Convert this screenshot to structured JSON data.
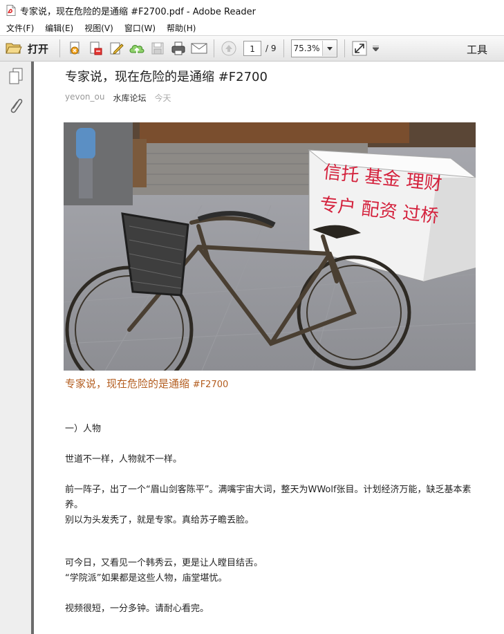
{
  "window": {
    "title": "专家说，现在危险的是通缩 #F2700.pdf - Adobe Reader"
  },
  "menu": [
    {
      "label": "文件(F)"
    },
    {
      "label": "编辑(E)"
    },
    {
      "label": "视图(V)"
    },
    {
      "label": "窗口(W)"
    },
    {
      "label": "帮助(H)"
    }
  ],
  "toolbar": {
    "open_label": "打开",
    "page_current": "1",
    "page_total": "/ 9",
    "zoom": "75.3%",
    "tools_label": "工具"
  },
  "article": {
    "title": "专家说，现在危险的是通缩 #F2700",
    "author": "yevon_ou",
    "source": "水库论坛",
    "date": "今天",
    "image_sign_text": [
      "信托 基金 理财",
      "专户 配资 过桥"
    ],
    "caption_main": "专家说，现在危险的是通缩",
    "caption_tag": "#F2700",
    "paragraphs": [
      "一）人物",
      "世道不一样，人物就不一样。",
      "前一阵子，出了一个“眉山剑客陈平”。满嘴宇宙大词，整天为WWolf张目。计划经济万能，缺乏基本素养。",
      "别以为头发秃了，就是专家。真给苏子瞻丢脸。",
      "可今日，又看见一个韩秀云，更是让人瞠目结舌。",
      "“学院派”如果都是这些人物，庙堂堪忧。",
      "视频很短，一分多钟。请耐心看完。"
    ]
  },
  "colors": {
    "caption": "#b35c1e",
    "sign_text": "#d4213c"
  }
}
